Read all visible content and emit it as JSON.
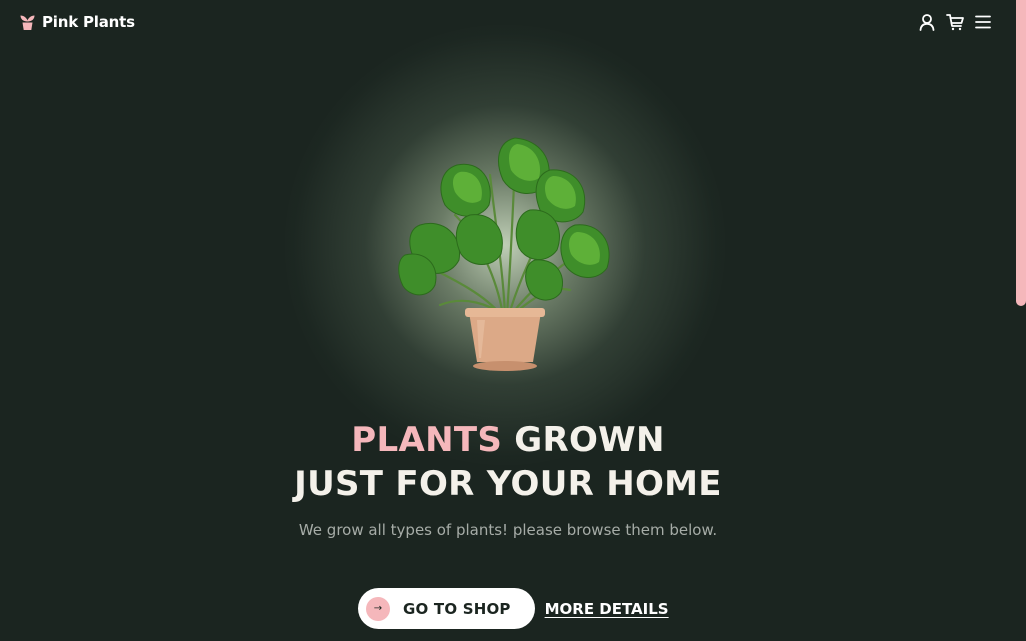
{
  "brand": {
    "name": "Pink Plants",
    "logo_icon": "pink-flower-pot-icon"
  },
  "nav": {
    "icons": [
      "user-icon",
      "cart-icon",
      "menu-icon"
    ]
  },
  "hero": {
    "image": "potted-monstera-plant",
    "headline_accent": "PLANTS",
    "headline_rest_line1": " GROWN",
    "headline_line2": "JUST FOR YOUR HOME",
    "subtitle": "We grow all types of plants! please browse them below.",
    "primary_button_label": "GO TO SHOP",
    "primary_button_icon": "→",
    "secondary_link_label": "MORE DETAILS"
  },
  "colors": {
    "background": "#1b2520",
    "accent_pink": "#f5b7bb",
    "text_light": "#f4f1ea",
    "text_muted": "#a6aca7"
  }
}
